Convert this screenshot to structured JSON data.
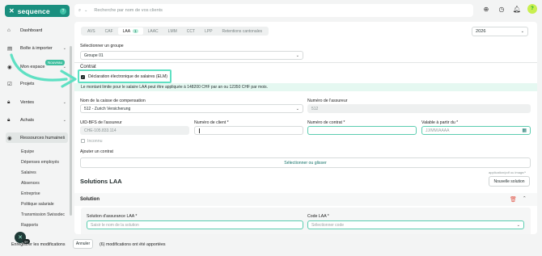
{
  "brand": {
    "name": "sequence",
    "badge": "?"
  },
  "search": {
    "placeholder": "Recherche par nom de vos clients"
  },
  "avatar_initial": "?",
  "sidebar": {
    "items": [
      {
        "label": "Dashboard",
        "icon": "home-icon"
      },
      {
        "label": "Boîte à importer",
        "icon": "inbox-icon"
      },
      {
        "label": "Mon espace",
        "icon": "person-icon"
      },
      {
        "label": "Projets",
        "icon": "check-square-icon"
      },
      {
        "label": "Ventes",
        "icon": "lock-icon"
      },
      {
        "label": "Achats",
        "icon": "lock-icon"
      },
      {
        "label": "Ressources humaines",
        "icon": "person-icon"
      }
    ],
    "new_badge": "Nouveau",
    "sub_items": [
      "Equipe",
      "Dépenses employés",
      "Salaires",
      "Absences",
      "Entreprise",
      "Politique salariale",
      "Transmission Swissdec",
      "Rapports"
    ]
  },
  "tabs": [
    {
      "label": "AVS"
    },
    {
      "label": "CAF"
    },
    {
      "label": "LAA",
      "count": "1"
    },
    {
      "label": "LAAC"
    },
    {
      "label": "LMM"
    },
    {
      "label": "CCT"
    },
    {
      "label": "LPP"
    },
    {
      "label": "Retentions cantonales"
    }
  ],
  "year": "2026",
  "group": {
    "label": "Sélectionner un groupe",
    "value": "Groupe 01"
  },
  "contract": {
    "title": "Contrat",
    "elm_checkbox": "Déclaration électronique de salaires (ELM)",
    "info": "Le montant limite pour le salaire LAA peut être appliquée à 148200 CHF par an ou 12350 CHF par mois."
  },
  "fields": {
    "caisse_label": "Nom de la caisse de compensation",
    "caisse_value": "512 - Zurich Versicherung",
    "assureur_num_label": "Numéro de l'assureur",
    "assureur_num_value": "512",
    "uid_label": "UID-BFS de l'assureur",
    "uid_value": "CHE-105.833.114",
    "client_label": "Numéro de client *",
    "contrat_label": "Numéro de contrat *",
    "valable_label": "Valable à partir du *",
    "valable_placeholder": "JJ/MM/AAAA",
    "inconnu": "Inconnu"
  },
  "add_contract": {
    "label": "Ajouter un contrat",
    "button": "Sélectionner ou glisser"
  },
  "solutions": {
    "title": "Solutions LAA",
    "hint": "application/pdf ou image/*",
    "new_button": "Nouvelle solution",
    "solution_label": "Solution",
    "insurance_solution_label": "Solution d'assurance LAA *",
    "insurance_solution_placeholder": "Saisir le nom de la solution",
    "code_label": "Code LAA *",
    "code_placeholder": "Sélectionner code"
  },
  "bottom": {
    "save_text": "Enregistrer les modifications",
    "cancel": "Annuler",
    "count_badge": "9+",
    "status": "(6) modifications ont été apportées"
  },
  "colors": {
    "brand": "#1a8f7f",
    "highlight": "#5fe0c3",
    "info_bg": "#e5f8f1",
    "accent_text": "#15736a"
  }
}
